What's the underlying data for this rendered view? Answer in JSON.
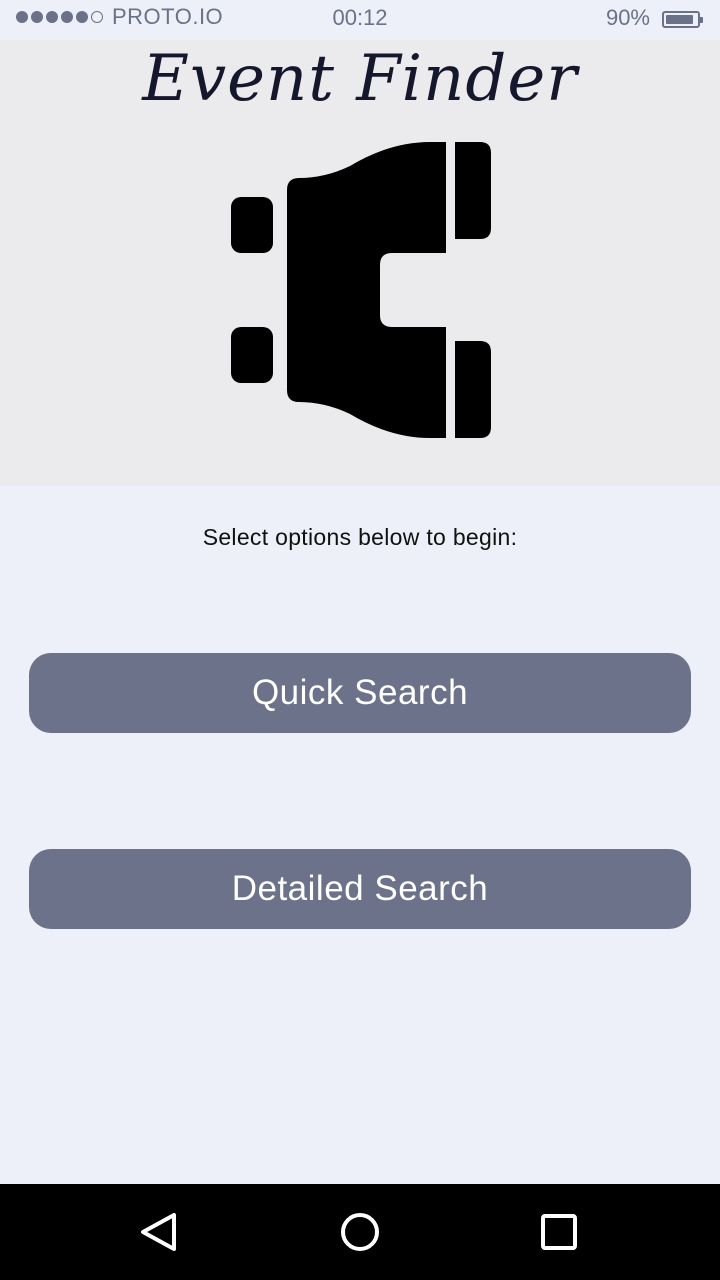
{
  "status_bar": {
    "carrier": "PROTO.IO",
    "time": "00:12",
    "battery_percent": "90%",
    "battery_level": 0.9,
    "signal_dots_filled": 5,
    "signal_dots_total": 6
  },
  "hero": {
    "title": "Event Finder",
    "icon": "binoculars-icon"
  },
  "main": {
    "instruction": "Select options below to begin:",
    "quick_search_label": "Quick Search",
    "detailed_search_label": "Detailed Search"
  },
  "nav_bar": {
    "back_icon": "back-triangle-icon",
    "home_icon": "home-circle-icon",
    "recent_icon": "recent-apps-square-icon"
  },
  "colors": {
    "background": "#edf0f8",
    "hero_background": "#ebebee",
    "button": "#6b7289",
    "status_text": "#6b7188",
    "title": "#15182c"
  }
}
